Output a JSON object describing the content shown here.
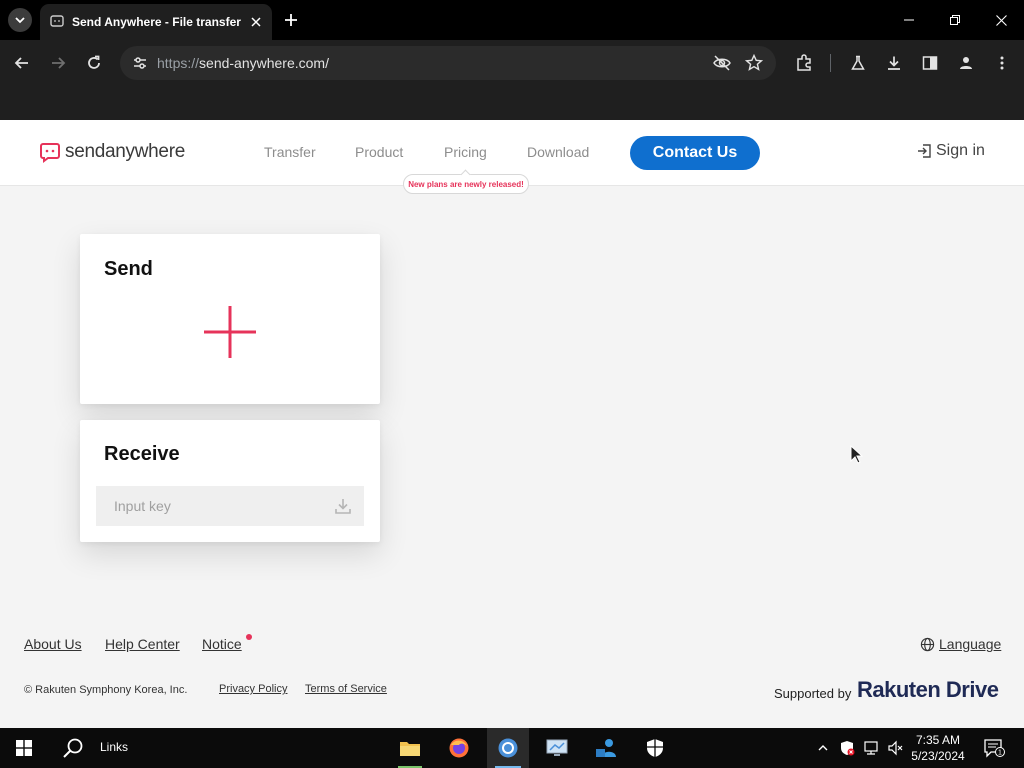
{
  "browser": {
    "tab_title": "Send Anywhere - File transfer",
    "url_protocol": "https://",
    "url_host": "send-anywhere.com/"
  },
  "site": {
    "logo_word": "sendanywhere",
    "nav": {
      "transfer": "Transfer",
      "product": "Product",
      "pricing": "Pricing",
      "download": "Download"
    },
    "pricing_badge": "New plans are newly released!",
    "contact_label": "Contact Us",
    "signin_label": "Sign in"
  },
  "send_card": {
    "title": "Send"
  },
  "receive_card": {
    "title": "Receive",
    "key_placeholder": "Input key"
  },
  "footer": {
    "about": "About Us",
    "help": "Help Center",
    "notice": "Notice",
    "language": "Language",
    "copyright": "© Rakuten Symphony Korea, Inc.",
    "privacy": "Privacy Policy",
    "terms": "Terms of Service",
    "supported_by": "Supported by",
    "sponsor_brand": "Rakuten Drive"
  },
  "taskbar": {
    "search_label": "Links",
    "time": "7:35 AM",
    "date": "5/23/2024",
    "notification_count": "1"
  },
  "colors": {
    "accent_pink": "#e6335a",
    "contact_blue": "#0f6fcf",
    "brand_navy": "#1f2a55"
  }
}
